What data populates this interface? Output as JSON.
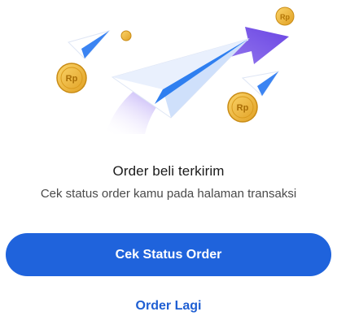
{
  "illustration": {
    "icon": "paper-plane-sent-icon",
    "coin_label": "Rp"
  },
  "message": {
    "title": "Order beli terkirim",
    "subtitle": "Cek status order kamu pada halaman transaksi"
  },
  "actions": {
    "primary_label": "Cek Status Order",
    "secondary_label": "Order Lagi"
  },
  "colors": {
    "primary": "#1f63dc",
    "accent_purple": "#7b55e8",
    "coin": "#f2b735"
  }
}
